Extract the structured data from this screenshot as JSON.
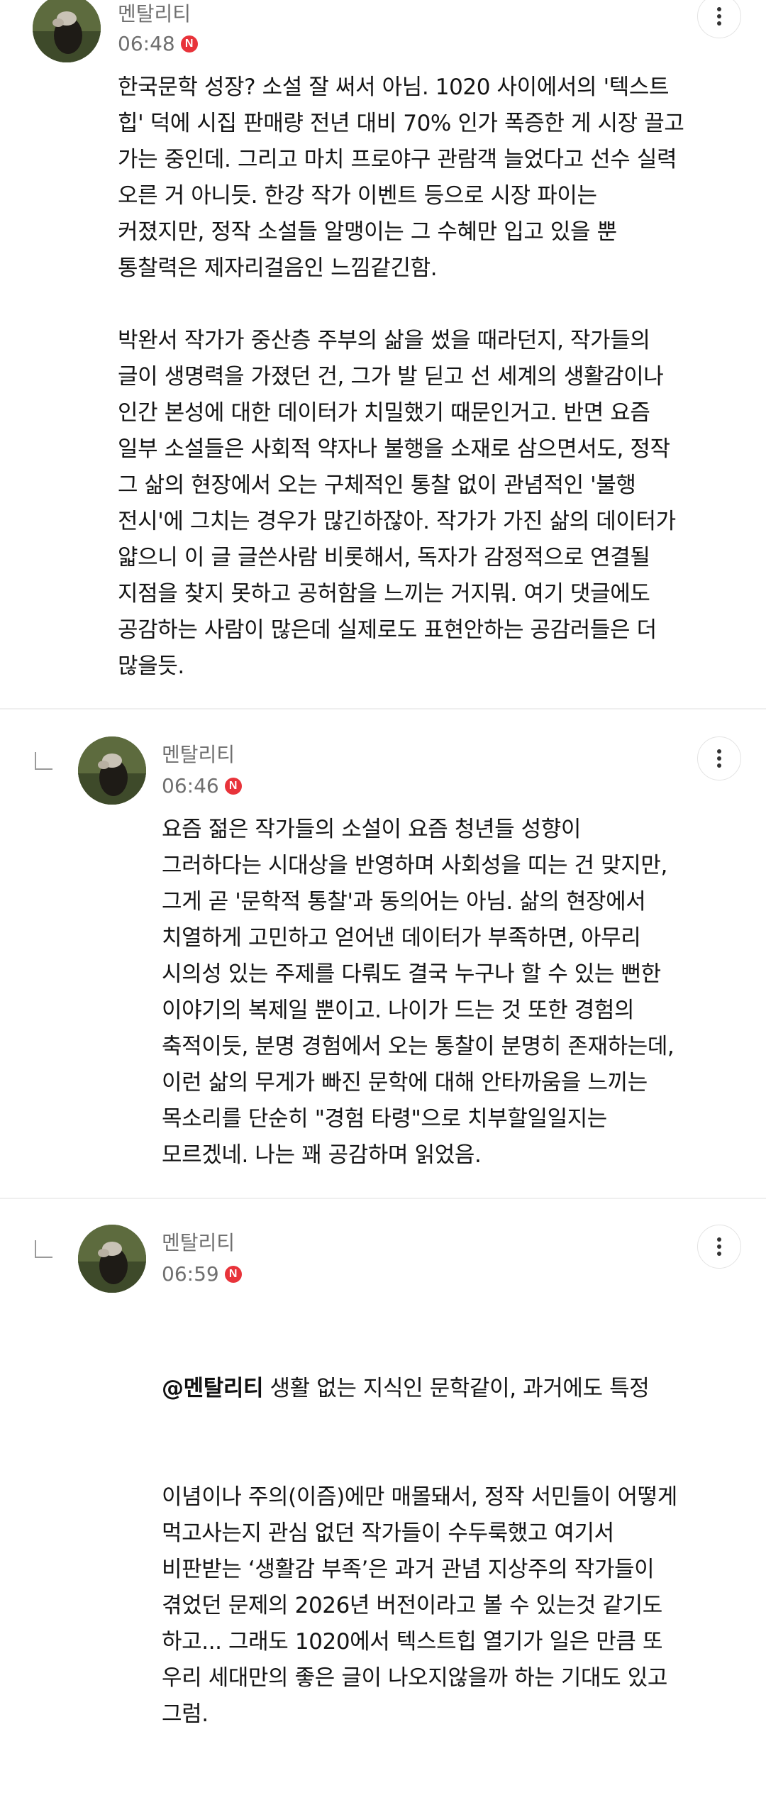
{
  "comments": [
    {
      "author": "멘탈리티",
      "time": "06:48",
      "badge": "N",
      "lines": [
        "한국문학 성장? 소설 잘 써서 아님. 1020 사이에서의 '텍스트",
        "힙' 덕에 시집 판매량 전년 대비 70% 인가 폭증한 게 시장 끌고",
        "가는 중인데. 그리고 마치 프로야구 관람객 늘었다고 선수 실력",
        "오른 거 아니듯. 한강 작가 이벤트 등으로 시장 파이는",
        "커졌지만, 정작 소설들 알맹이는 그 수혜만 입고 있을 뿐",
        "통찰력은 제자리걸음인 느낌같긴함.",
        "",
        "박완서 작가가 중산층 주부의 삶을 썼을 때라던지, 작가들의",
        "글이 생명력을 가졌던 건, 그가 발 딛고 선 세계의 생활감이나",
        "인간 본성에 대한 데이터가 치밀했기 때문인거고. 반면 요즘",
        "일부 소설들은 사회적 약자나 불행을 소재로 삼으면서도, 정작",
        "그 삶의 현장에서 오는 구체적인 통찰 없이 관념적인 '불행",
        "전시'에 그치는 경우가 많긴하잖아. 작가가 가진 삶의 데이터가",
        "얇으니 이 글 글쓴사람 비롯해서, 독자가 감정적으로 연결될",
        "지점을 찾지 못하고 공허함을 느끼는 거지뭐. 여기 댓글에도",
        "공감하는 사람이 많은데 실제로도 표현안하는 공감러들은 더",
        "많을듯."
      ]
    },
    {
      "author": "멘탈리티",
      "time": "06:46",
      "badge": "N",
      "lines": [
        "요즘 젊은 작가들의 소설이 요즘 청년들 성향이",
        "그러하다는 시대상을 반영하며 사회성을 띠는 건 맞지만,",
        "그게 곧 '문학적 통찰'과 동의어는 아님. 삶의 현장에서",
        "치열하게 고민하고 얻어낸 데이터가 부족하면, 아무리",
        "시의성 있는 주제를 다뤄도 결국 누구나 할 수 있는 뻔한",
        "이야기의 복제일 뿐이고. 나이가 드는 것 또한 경험의",
        "축적이듯, 분명 경험에서 오는 통찰이 분명히 존재하는데,",
        "이런 삶의 무게가 빠진 문학에 대해 안타까움을 느끼는",
        "목소리를 단순히 \"경험 타령\"으로 치부할일일지는",
        "모르겠네. 나는 꽤 공감하며 읽었음."
      ]
    },
    {
      "author": "멘탈리티",
      "time": "06:59",
      "badge": "N",
      "mention": "@멘탈리티",
      "first_line_rest": " 생활 없는 지식인 문학같이, 과거에도 특정",
      "lines": [
        "이념이나 주의(이즘)에만 매몰돼서, 정작 서민들이 어떻게",
        "먹고사는지 관심 없던 작가들이 수두룩했고 여기서",
        "비판받는 ‘생활감 부족’은 과거 관념 지상주의 작가들이",
        "겪었던 문제의 2026년 버전이라고 볼 수 있는것 같기도",
        "하고... 그래도 1020에서 텍스트힙 열기가 일은 만큼 또",
        "우리 세대만의 좋은 글이 나오지않을까 하는 기대도 있고",
        "그럼."
      ]
    }
  ],
  "icons": {
    "more": "more-vertical-icon",
    "reply": "reply-arrow-icon",
    "badge_color": "#e8333a"
  }
}
